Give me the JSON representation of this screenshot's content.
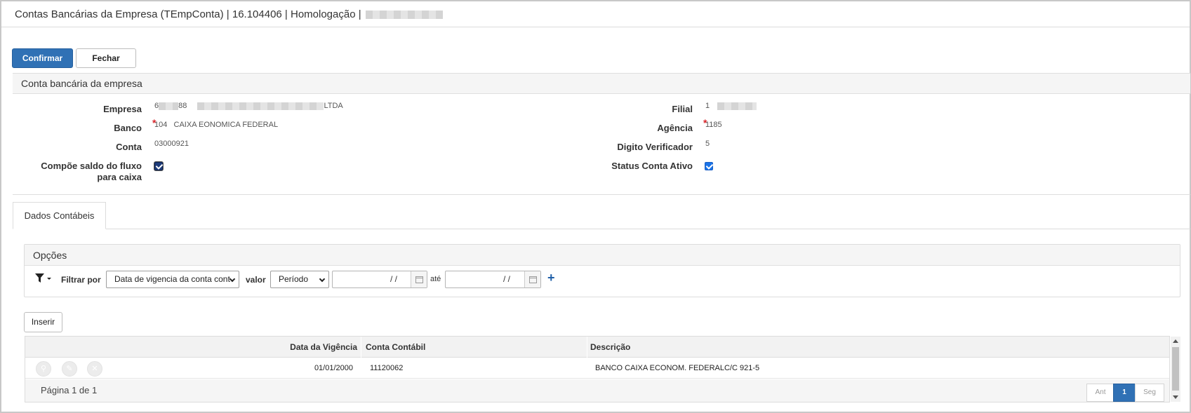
{
  "window": {
    "title": "Contas Bancárias da Empresa (TEmpConta) | 16.104406 | Homologação |"
  },
  "toolbar": {
    "confirm_label": "Confirmar",
    "close_label": "Fechar"
  },
  "section": {
    "title": "Conta bancária da empresa",
    "fields": {
      "empresa": {
        "label": "Empresa",
        "code_start": "6",
        "code_end": "88",
        "name_end": "LTDA"
      },
      "filial": {
        "label": "Filial",
        "code": "1"
      },
      "banco": {
        "label": "Banco",
        "code": "104",
        "name": "CAIXA EONOMICA FEDERAL",
        "required": "*"
      },
      "agencia": {
        "label": "Agência",
        "value": "1185",
        "required": "*"
      },
      "conta": {
        "label": "Conta",
        "value": "03000921"
      },
      "digito": {
        "label": "Digito Verificador",
        "value": "5"
      },
      "compoe": {
        "label_line1": "Compõe saldo do fluxo",
        "label_line2": "para caixa",
        "checked": true
      },
      "status": {
        "label": "Status Conta Ativo",
        "checked": true
      }
    }
  },
  "tabs": [
    {
      "label": "Dados Contábeis",
      "active": true
    }
  ],
  "options": {
    "title": "Opções",
    "filter_label": "Filtrar por",
    "filter_field": "Data de vigencia da conta cont",
    "value_label": "valor",
    "value_type": "Período",
    "date_from_mask": "/  /",
    "ate_label": "até",
    "date_to_mask": "/  /",
    "add_symbol": "+"
  },
  "grid": {
    "insert_label": "Inserir",
    "columns": [
      "Data da Vigência",
      "Conta Contábil",
      "Descrição"
    ],
    "rows": [
      {
        "data_vigencia": "01/01/2000",
        "conta_contabil": "11120062",
        "descricao": "BANCO CAIXA ECONOM. FEDERALC/C 921-5"
      }
    ],
    "page_info": "Página 1 de 1",
    "pager": {
      "prev": "Ant",
      "current": "1",
      "next": "Seg"
    }
  }
}
